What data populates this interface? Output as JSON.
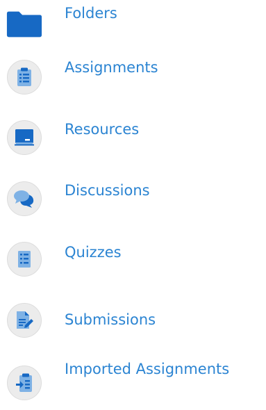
{
  "nav": {
    "items": [
      {
        "label": "Folders",
        "icon": "folder-icon"
      },
      {
        "label": "Assignments",
        "icon": "clipboard-icon"
      },
      {
        "label": "Resources",
        "icon": "presentation-board-icon"
      },
      {
        "label": "Discussions",
        "icon": "chat-bubbles-icon"
      },
      {
        "label": "Quizzes",
        "icon": "checklist-icon"
      },
      {
        "label": "Submissions",
        "icon": "document-edit-icon"
      },
      {
        "label": "Imported Assignments",
        "icon": "clipboard-import-icon"
      }
    ]
  },
  "colors": {
    "link": "#2b84d2",
    "icon_blue": "#1769c4",
    "icon_light_blue": "#7fb2e5",
    "circle_bg": "#ececec"
  }
}
